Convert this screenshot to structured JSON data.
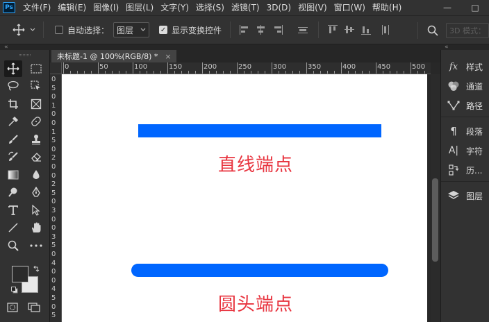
{
  "app": {
    "logo": "Ps"
  },
  "menu": [
    "文件(F)",
    "编辑(E)",
    "图像(I)",
    "图层(L)",
    "文字(Y)",
    "选择(S)",
    "滤镜(T)",
    "3D(D)",
    "视图(V)",
    "窗口(W)",
    "帮助(H)"
  ],
  "window_controls": {
    "minimize": "—",
    "maximize": "□"
  },
  "options": {
    "auto_select_label": "自动选择：",
    "auto_select_checked": false,
    "target_value": "图层",
    "show_transform_label": "显示变换控件",
    "show_transform_checked": true,
    "view3d_label": "3D 模式："
  },
  "collapse_glyph": "«",
  "document": {
    "tab_title": "未标题-1 @ 100%(RGB/8) *",
    "close_glyph": "×"
  },
  "ruler": {
    "top_labels": [
      "0",
      "50",
      "100",
      "150",
      "200",
      "250",
      "300",
      "350",
      "400",
      "450",
      "500"
    ],
    "left_labels": [
      "0",
      "5",
      "0",
      "1",
      "0",
      "0",
      "1",
      "5",
      "0",
      "2",
      "0",
      "0",
      "2",
      "5",
      "0",
      "3",
      "0",
      "0",
      "3",
      "5",
      "0",
      "4",
      "0",
      "0",
      "4",
      "5",
      "0",
      "5"
    ]
  },
  "canvas": {
    "background": "#ffffff",
    "line_color": "#0066ff",
    "label_color": "#e8343f",
    "label_butt": "直线端点",
    "label_round": "圆头端点"
  },
  "colors": {
    "foreground": "#2b2b2b",
    "background": "#e8e8e8"
  },
  "panels": [
    {
      "icon": "fx-icon",
      "glyph": "fx",
      "label": "样式"
    },
    {
      "icon": "channels-icon",
      "glyph": "◕",
      "label": "通道"
    },
    {
      "icon": "paths-icon",
      "glyph": "⌇",
      "label": "路径"
    },
    {
      "icon": "paragraph-icon",
      "glyph": "¶",
      "label": "段落"
    },
    {
      "icon": "character-icon",
      "glyph": "A|",
      "label": "字符"
    },
    {
      "icon": "history-icon",
      "glyph": "⎘",
      "label": "历..."
    },
    {
      "icon": "layers-icon",
      "glyph": "◈",
      "label": "图层"
    }
  ]
}
